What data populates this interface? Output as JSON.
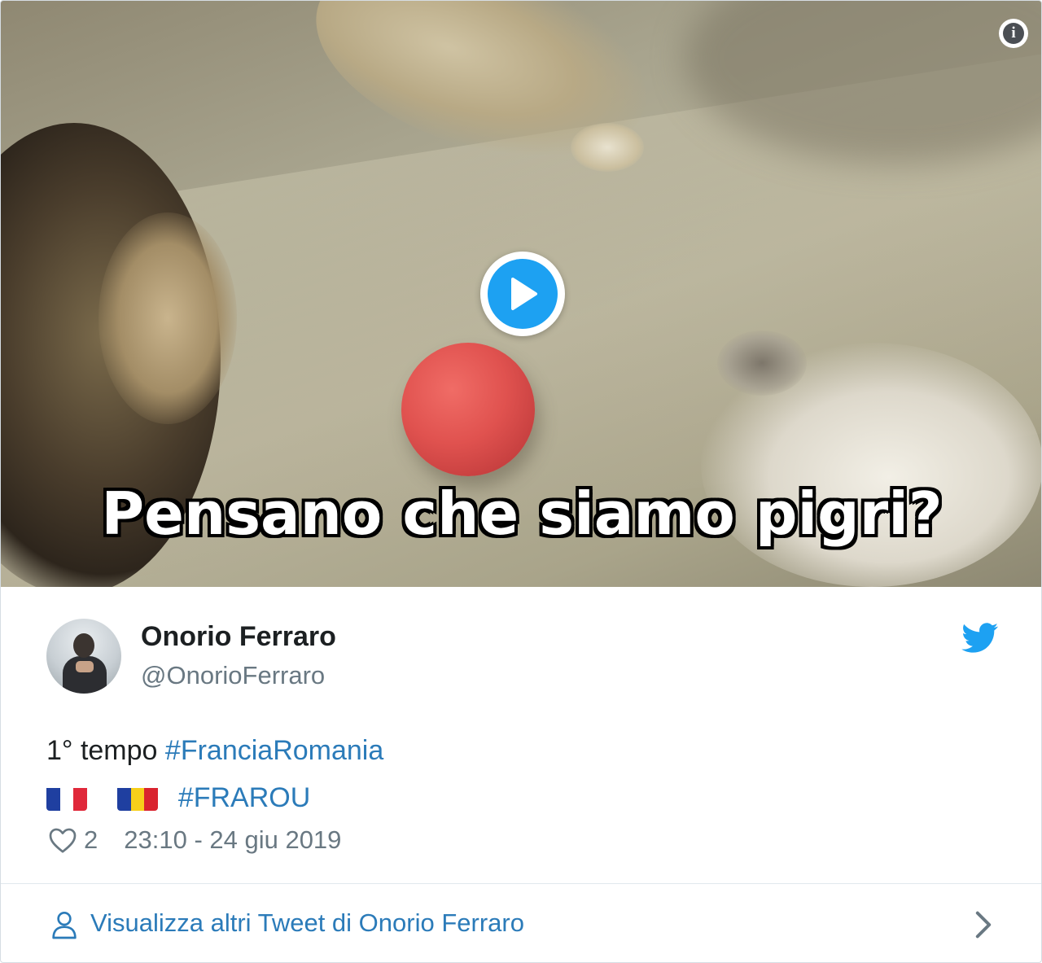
{
  "media": {
    "caption": "Pensano che siamo pigri?"
  },
  "author": {
    "display_name": "Onorio Ferraro",
    "handle": "@OnorioFerraro"
  },
  "tweet": {
    "line1_text": "1° tempo ",
    "line1_hashtag": "#FranciaRomania",
    "line2_hashtag": "#FRAROU",
    "flags": [
      "france-flag",
      "romania-flag"
    ]
  },
  "meta": {
    "like_count": "2",
    "timestamp": "23:10 - 24 giu 2019"
  },
  "footer": {
    "label": "Visualizza altri Tweet di Onorio Ferraro"
  },
  "colors": {
    "twitter_blue": "#1da1f2",
    "link_blue": "#2b7bb9",
    "secondary_text": "#697882",
    "ball_red": "#e0524f"
  },
  "icons": [
    "info-icon",
    "play-icon",
    "twitter-bird-icon",
    "heart-icon",
    "person-icon",
    "chevron-right-icon"
  ]
}
